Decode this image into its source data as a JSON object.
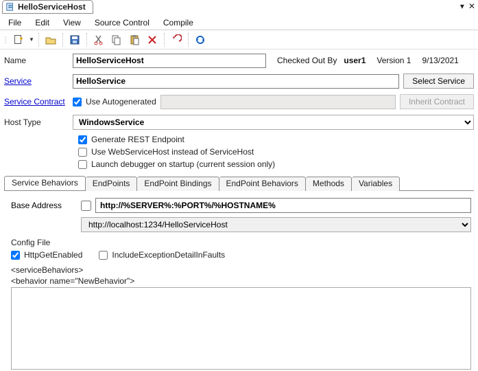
{
  "documentTab": {
    "title": "HelloServiceHost"
  },
  "menu": {
    "file": "File",
    "edit": "Edit",
    "view": "View",
    "sourceControl": "Source Control",
    "compile": "Compile"
  },
  "toolbar": {
    "new": "new",
    "open": "open",
    "save": "save",
    "cut": "cut",
    "copy": "copy",
    "paste": "paste",
    "delete": "delete",
    "undo": "undo",
    "refresh": "refresh"
  },
  "form": {
    "nameLabel": "Name",
    "nameValue": "HelloServiceHost",
    "checkedOutByLabel": "Checked Out By",
    "checkedOutByUser": "user1",
    "versionLabel": "Version 1",
    "date": "9/13/2021",
    "serviceLabel": "Service",
    "serviceValue": "HelloService",
    "selectServiceBtn": "Select Service",
    "serviceContractLabel": "Service Contract",
    "useAutogenerated": "Use Autogenerated",
    "inheritContractBtn": "Inherit Contract",
    "hostTypeLabel": "Host Type",
    "hostTypeValue": "WindowsService",
    "generateRest": "Generate REST Endpoint",
    "useWebServiceHost": "Use WebServiceHost instead of ServiceHost",
    "launchDebugger": "Launch debugger on startup (current session only)"
  },
  "tabs": {
    "serviceBehaviors": "Service Behaviors",
    "endPoints": "EndPoints",
    "endPointBindings": "EndPoint Bindings",
    "endPointBehaviors": "EndPoint Behaviors",
    "methods": "Methods",
    "variables": "Variables"
  },
  "behaviors": {
    "baseAddressLabel": "Base Address",
    "baseAddressValue": "http://%SERVER%:%PORT%/%HOSTNAME%",
    "resolvedAddress": "http://localhost:1234/HelloServiceHost",
    "configFileLabel": "Config File",
    "httpGetEnabled": "HttpGetEnabled",
    "includeException": "IncludeExceptionDetailInFaults",
    "xml1": "<serviceBehaviors>",
    "xml2": "<behavior name=\"NewBehavior\">",
    "textareaValue": ""
  }
}
